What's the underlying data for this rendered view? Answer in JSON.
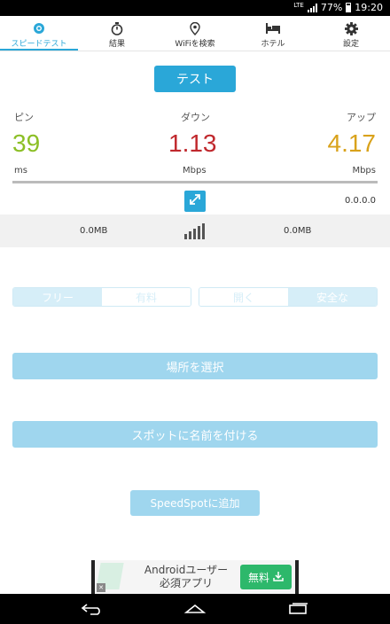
{
  "status_bar": {
    "network": "LTE",
    "battery": "77%",
    "time": "19:20"
  },
  "tabs": [
    {
      "label": "スピードテスト",
      "icon": "speedtest-icon",
      "active": true
    },
    {
      "label": "結果",
      "icon": "stopwatch-icon",
      "active": false
    },
    {
      "label": "WiFiを検索",
      "icon": "location-pin-icon",
      "active": false
    },
    {
      "label": "ホテル",
      "icon": "bed-icon",
      "active": false
    },
    {
      "label": "設定",
      "icon": "gear-icon",
      "active": false
    }
  ],
  "test_button": "テスト",
  "metrics": {
    "ping": {
      "label": "ピン",
      "value": "39",
      "unit": "ms",
      "color": "#8cbf26"
    },
    "download": {
      "label": "ダウン",
      "value": "1.13",
      "unit": "Mbps",
      "color": "#c0282d"
    },
    "upload": {
      "label": "アップ",
      "value": "4.17",
      "unit": "Mbps",
      "color": "#d9a21b"
    }
  },
  "ip_address": "0.0.0.0",
  "data_usage": {
    "left": "0.0MB",
    "right": "0.0MB"
  },
  "toggle_price": {
    "free": "フリー",
    "paid": "有料"
  },
  "toggle_security": {
    "open": "開く",
    "secure": "安全な"
  },
  "select_location": "場所を選択",
  "name_spot": "スポットに名前を付ける",
  "add_speedspot": "SpeedSpotに追加",
  "ad": {
    "line1": "Androidユーザー",
    "line2": "必須アプリ",
    "button": "無料",
    "close": "✕"
  },
  "colors": {
    "accent": "#2aa7d8",
    "light_accent": "#9fd6ee"
  }
}
